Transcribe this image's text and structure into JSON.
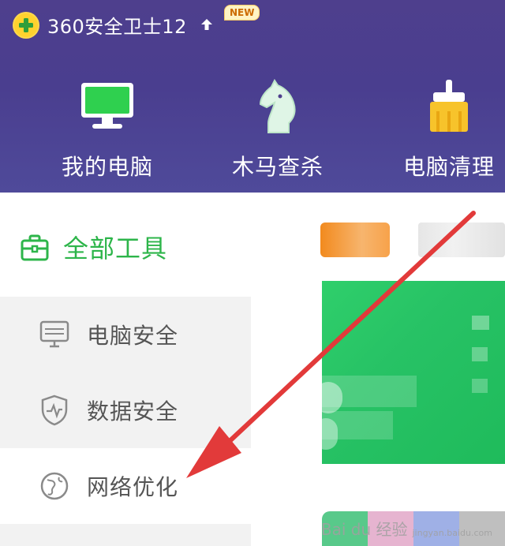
{
  "app": {
    "title": "360安全卫士12",
    "badge": "NEW"
  },
  "nav": {
    "items": [
      {
        "label": "我的电脑",
        "icon": "monitor-icon"
      },
      {
        "label": "木马查杀",
        "icon": "horse-icon"
      },
      {
        "label": "电脑清理",
        "icon": "broom-icon"
      }
    ]
  },
  "sidebar": {
    "section_title": "全部工具",
    "section_icon": "toolbox-icon",
    "items": [
      {
        "label": "电脑安全",
        "icon": "monitor-outline-icon"
      },
      {
        "label": "数据安全",
        "icon": "shield-pulse-icon"
      },
      {
        "label": "网络优化",
        "icon": "globe-icon",
        "active": true
      }
    ]
  },
  "watermark": {
    "brand": "Bai du 经验",
    "url": "jingyan.baidu.com"
  },
  "colors": {
    "header_bg": "#4e3f8d",
    "accent_green": "#2db54a",
    "arrow_red": "#e23a3a"
  }
}
